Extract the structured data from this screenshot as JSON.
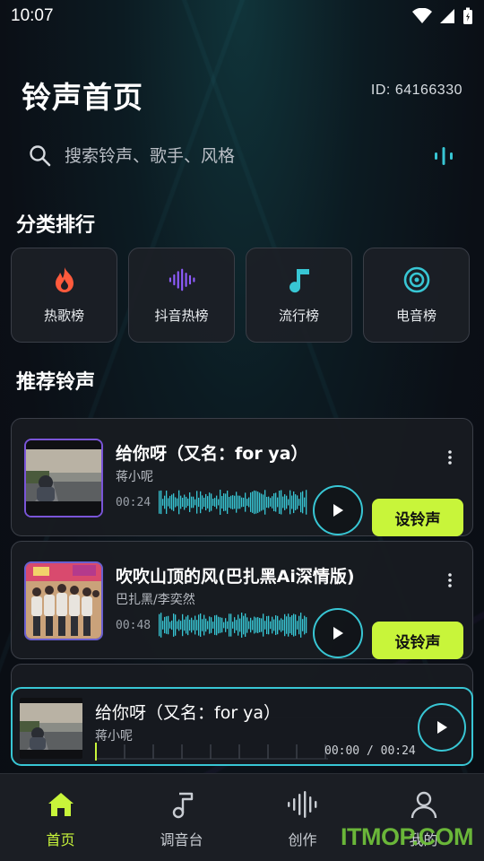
{
  "status_bar": {
    "time": "10:07"
  },
  "header": {
    "title": "铃声首页",
    "user_id": "ID: 64166330"
  },
  "search": {
    "placeholder": "搜索铃声、歌手、风格"
  },
  "categories": {
    "title": "分类排行",
    "items": [
      {
        "label": "热歌榜",
        "icon": "flame-icon",
        "color": "#ff5a3c"
      },
      {
        "label": "抖音热榜",
        "icon": "soundwave-icon",
        "color": "#8f5cff"
      },
      {
        "label": "流行榜",
        "icon": "music-note-icon",
        "color": "#38c6d4"
      },
      {
        "label": "电音榜",
        "icon": "target-icon",
        "color": "#38c6d4"
      }
    ]
  },
  "recommended": {
    "title": "推荐铃声",
    "songs": [
      {
        "title": "给你呀（又名：for ya）",
        "artist": "蒋小呢",
        "duration": "00:24",
        "action": "设铃声"
      },
      {
        "title": "吹吹山顶的风(巴扎黑Ai深情版)",
        "artist": "巴扎黑/李奕然",
        "duration": "00:48",
        "action": "设铃声"
      }
    ]
  },
  "mini_player": {
    "title": "给你呀（又名：for ya）",
    "artist": "蒋小呢",
    "time": "00:00 / 00:24",
    "progress": 0
  },
  "bottom_nav": [
    {
      "label": "首页",
      "icon": "home-icon",
      "active": true
    },
    {
      "label": "调音台",
      "icon": "music-note-icon",
      "active": false
    },
    {
      "label": "创作",
      "icon": "soundwave-icon",
      "active": false
    },
    {
      "label": "我的",
      "icon": "user-icon",
      "active": false
    }
  ],
  "watermark": "ITMOP.COM",
  "colors": {
    "accent": "#c8f53a",
    "cyan": "#38c6d4",
    "purple": "#8f5cff",
    "fire": "#ff5a3c"
  }
}
